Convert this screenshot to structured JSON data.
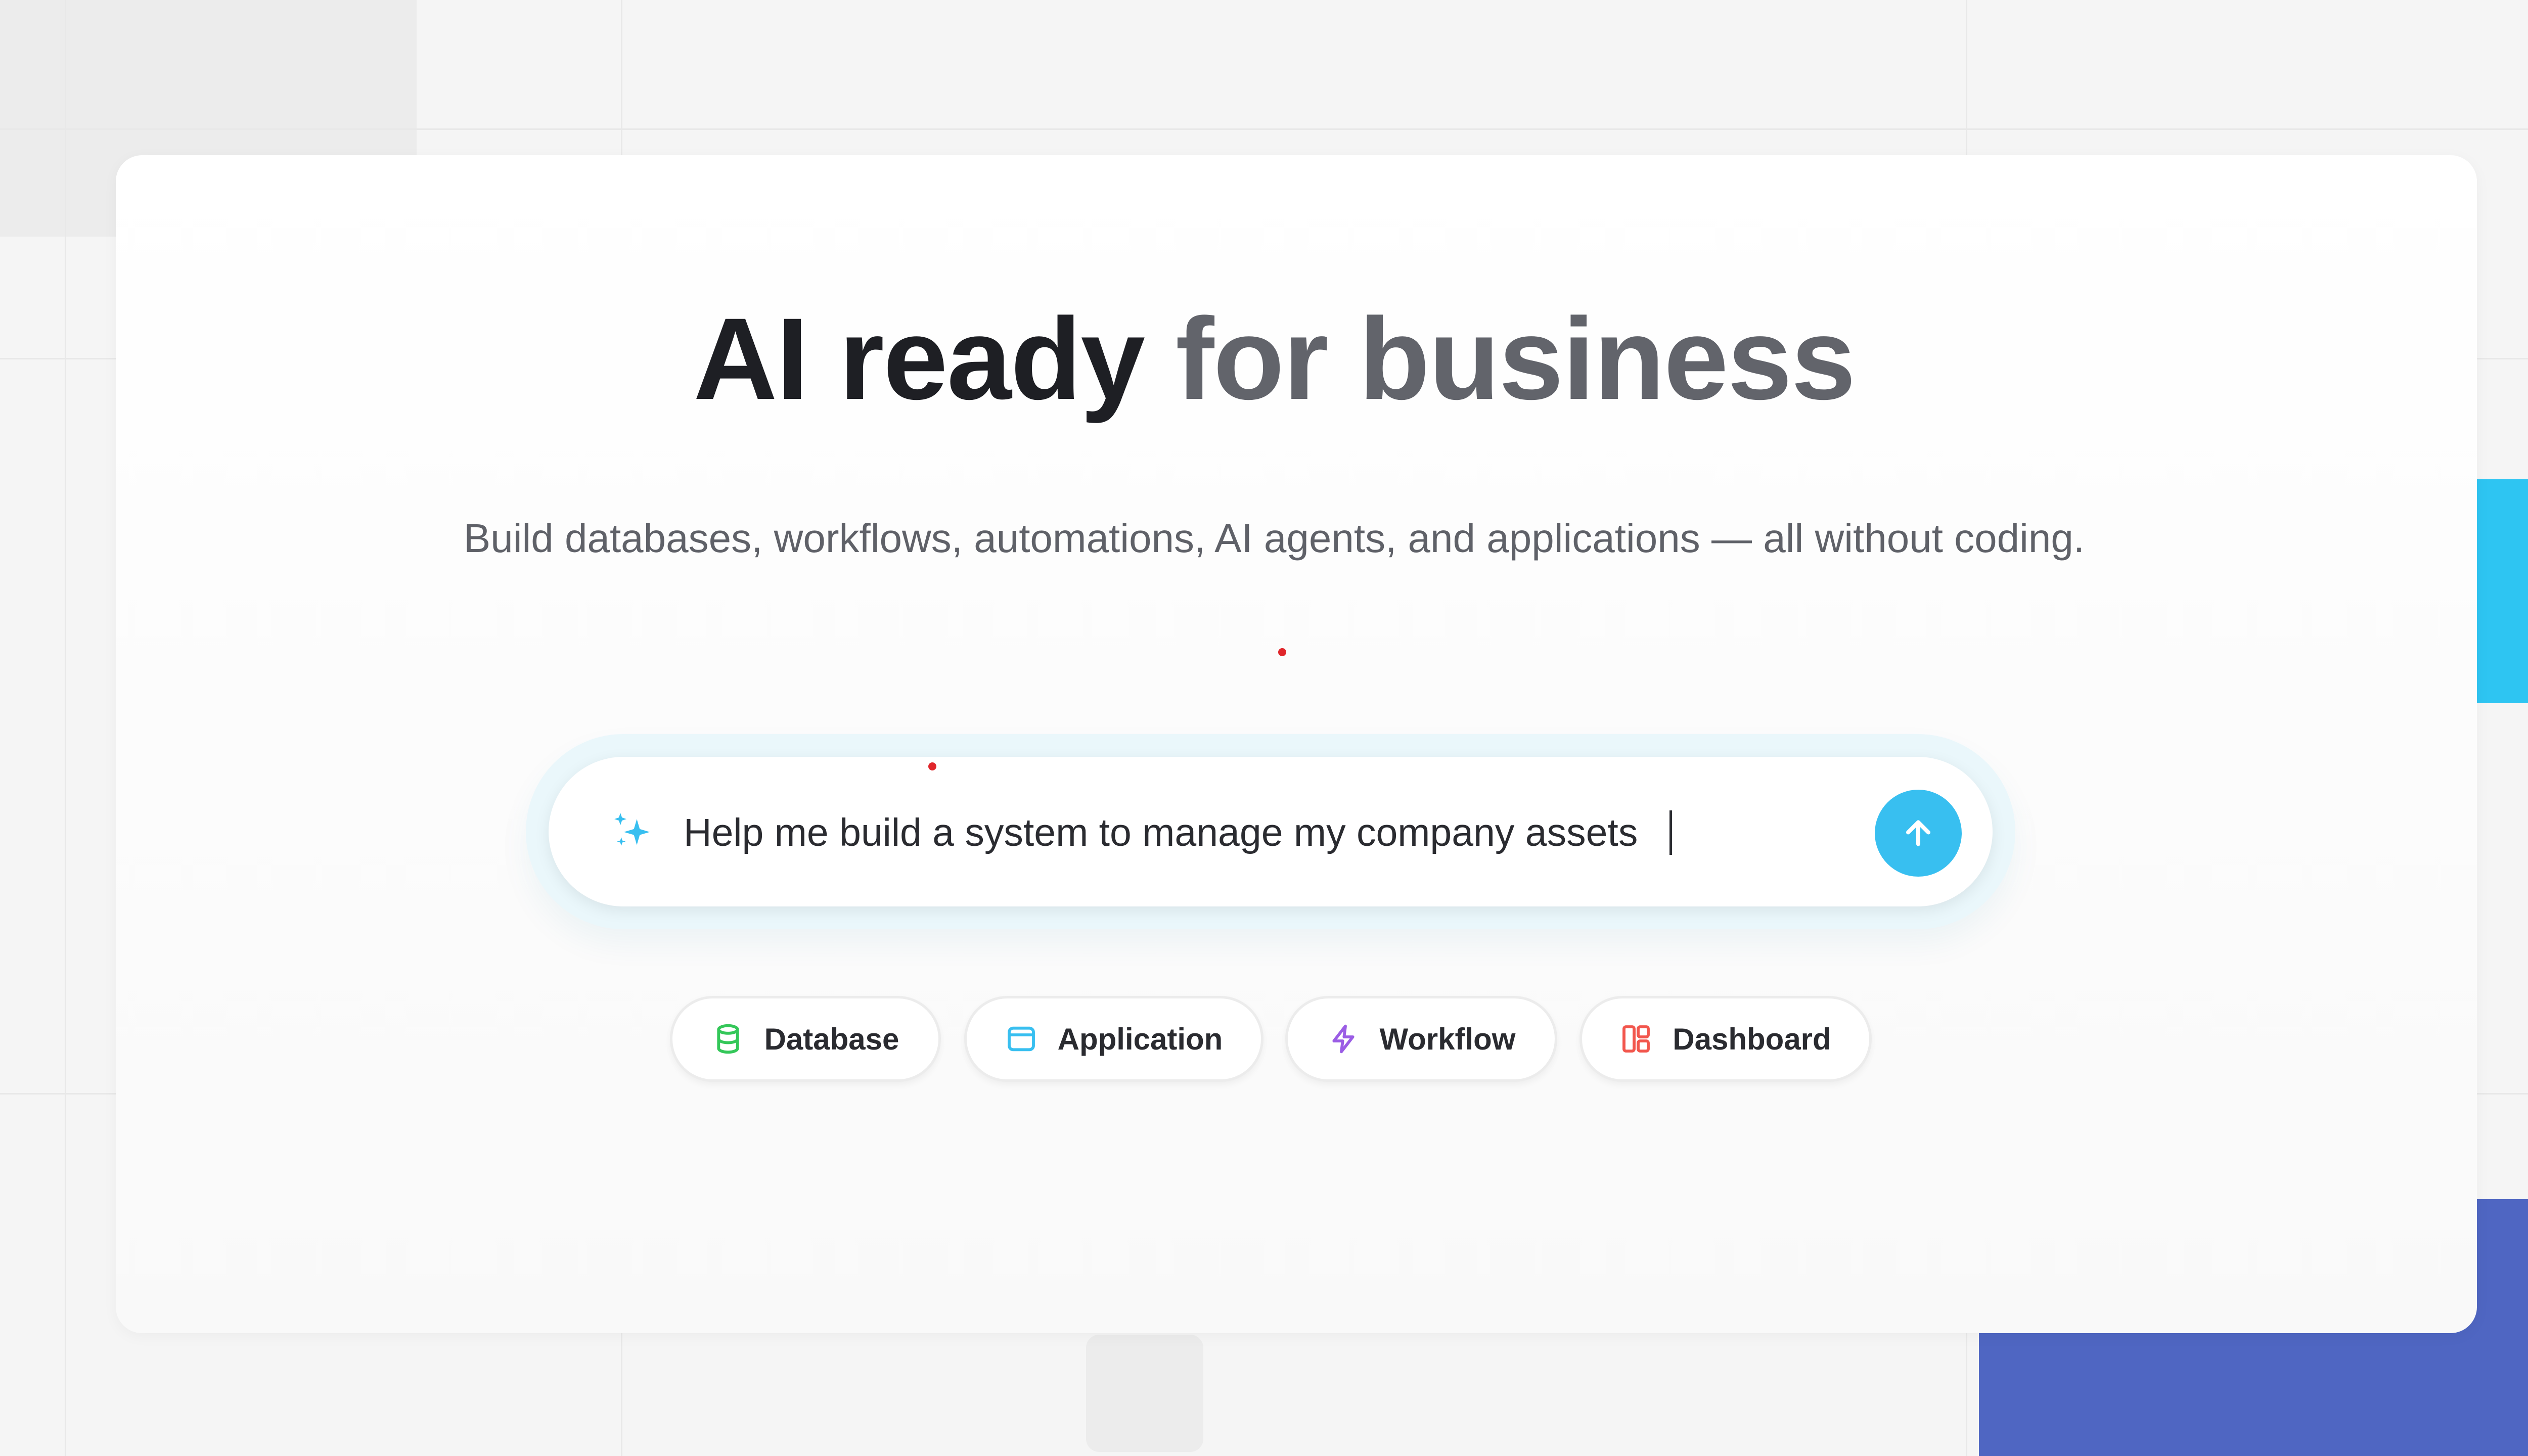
{
  "hero": {
    "title_strong": "AI ready",
    "title_muted": "for business",
    "subtitle": "Build databases, workflows, automations, AI agents, and applications — all without coding."
  },
  "prompt": {
    "value": "Help me build a system to manage my company assets",
    "icon": "sparkle-icon",
    "submit_icon": "arrow-up-icon"
  },
  "chips": [
    {
      "label": "Database",
      "icon": "database-icon",
      "color": "#34c759"
    },
    {
      "label": "Application",
      "icon": "window-icon",
      "color": "#38bff0"
    },
    {
      "label": "Workflow",
      "icon": "lightning-icon",
      "color": "#9b5de5"
    },
    {
      "label": "Dashboard",
      "icon": "dashboard-icon",
      "color": "#f2564d"
    }
  ],
  "colors": {
    "accent": "#38bff0",
    "side_tab": "#2ec5f2",
    "footer_block": "#4f66c2"
  }
}
